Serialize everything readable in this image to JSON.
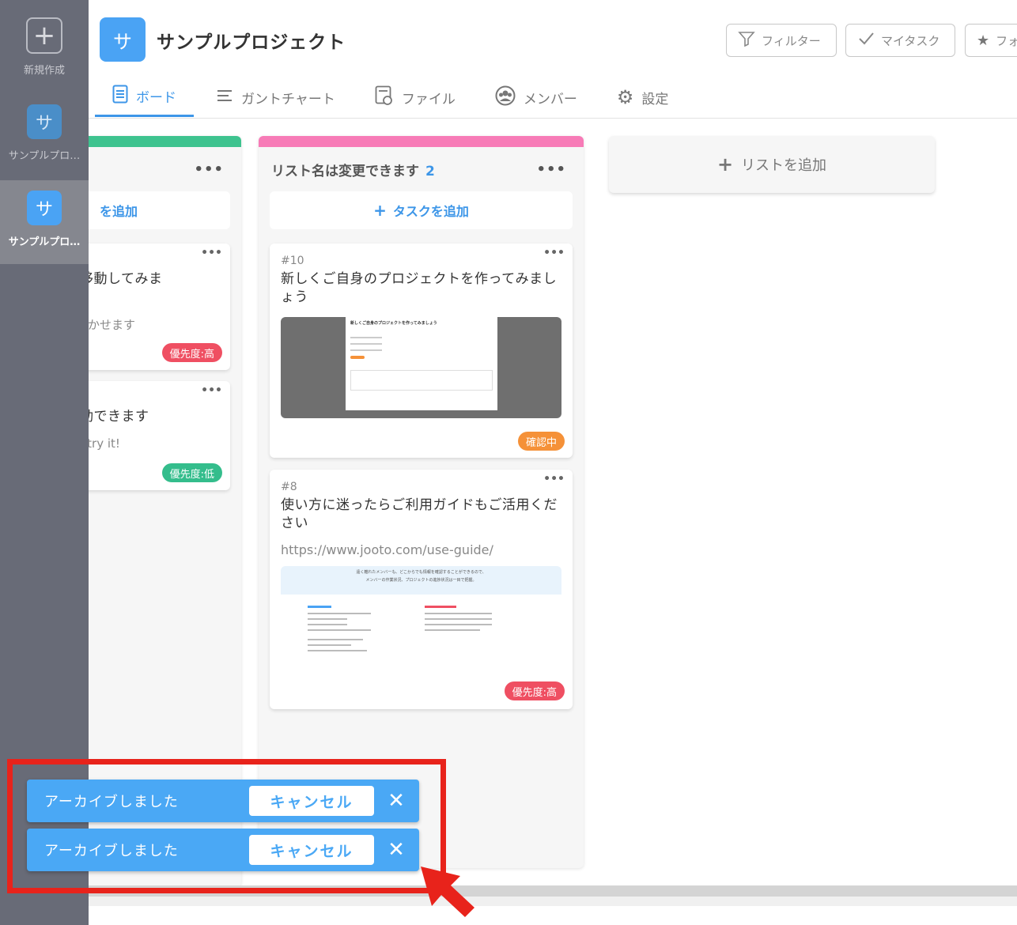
{
  "sidebar": {
    "new_label": "新規作成",
    "projects": [
      {
        "icon_char": "サ",
        "label": "サンプルプロ…"
      },
      {
        "icon_char": "サ",
        "label": "サンプルプロ…"
      }
    ]
  },
  "header": {
    "project_icon": "サ",
    "project_title": "サンプルプロジェクト",
    "buttons": {
      "filter": "フィルター",
      "mytask": "マイタスク",
      "favorite": "フォ"
    },
    "tabs": [
      "ボード",
      "ガントチャート",
      "ファイル",
      "メンバー",
      "設定"
    ]
  },
  "lists": [
    {
      "name": "",
      "bar_color": "#3ec38f",
      "add_task": "を追加",
      "cards": [
        {
          "title": "トに移動してみま",
          "sub": "プで動かせます",
          "badge": "優先度:高"
        },
        {
          "title": "に移動できます",
          "sub": "t too. try it!",
          "badge": "優先度:低"
        }
      ]
    },
    {
      "name": "リスト名は変更できます",
      "count": "2",
      "bar_color": "#f77bb7",
      "add_task": "タスクを追加",
      "cards": [
        {
          "num": "#10",
          "title": "新しくご自身のプロジェクトを作ってみましょう",
          "badge": "確認中",
          "thumb_title": "新しくご自身のプロジェクトを作ってみましょう"
        },
        {
          "num": "#8",
          "title": "使い方に迷ったらご利用ガイドもご活用ください",
          "url": "https://www.jooto.com/use-guide/",
          "badge": "優先度:高",
          "thumb_line1": "遠く離れたメンバーも、どこからでも情報を確認することができるので、",
          "thumb_line2": "メンバーの作業状況、プロジェクトの進捗状況は一目で把握。"
        }
      ]
    }
  ],
  "add_list_label": "リストを追加",
  "toasts": [
    {
      "message": "アーカイブしました",
      "cancel": "キャンセル"
    },
    {
      "message": "アーカイブしました",
      "cancel": "キャンセル"
    }
  ],
  "colors": {
    "accent": "#3d96e8",
    "highlight": "#e8231b",
    "sidebar": "#686b77"
  }
}
